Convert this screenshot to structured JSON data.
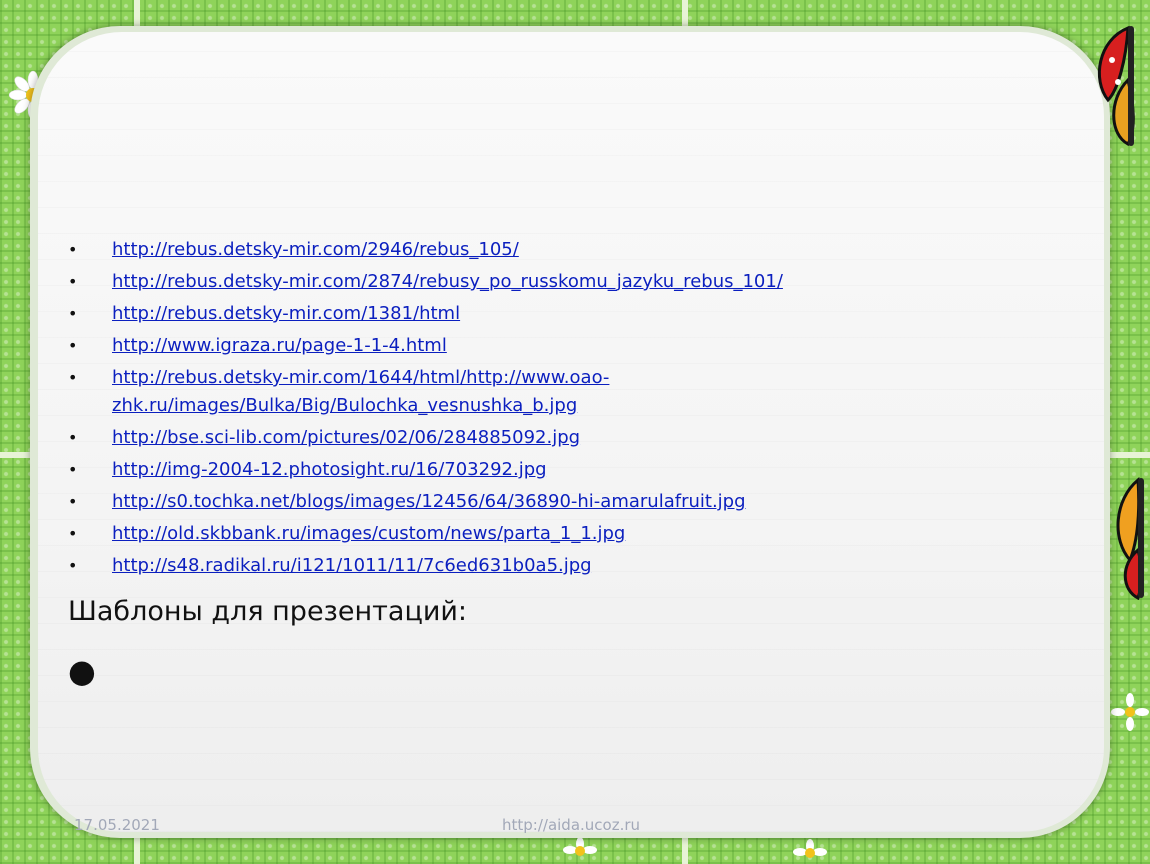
{
  "links": [
    {
      "text": "http://rebus.detsky-mir.com/2946/rebus_105/"
    },
    {
      "text": "http://rebus.detsky-mir.com/2874/rebusy_po_russkomu_jazyku_rebus_101/"
    },
    {
      "text": "http://rebus.detsky-mir.com/1381/html"
    },
    {
      "text": "http://www.igraza.ru/page-1-1-4.html"
    },
    {
      "text": "http://rebus.detsky-mir.com/1644/html/http://www.oao-",
      "text2": "zhk.ru/images/Bulka/Big/Bulochka_vesnushka_b.jpg"
    },
    {
      "text": "http://bse.sci-lib.com/pictures/02/06/284885092.jpg"
    },
    {
      "text": "http://img-2004-12.photosight.ru/16/703292.jpg"
    },
    {
      "text": "http://s0.tochka.net/blogs/images/12456/64/36890-hi-amarulafruit.jpg"
    },
    {
      "text": "http://old.skbbank.ru/images/custom/news/parta_1_1.jpg"
    },
    {
      "text": "http://s48.radikal.ru/i121/1011/11/7c6ed631b0a5.jpg"
    }
  ],
  "section_title": "Шаблоны для презентаций:",
  "bullet_glyph": "•",
  "big_bullet_glyph": "●",
  "footer": {
    "date": "17.05.2021",
    "url": "http://aida.ucoz.ru"
  },
  "colors": {
    "link": "#0b1fbf",
    "background": "#8fd35a",
    "footer": "#a2a8b8"
  },
  "decorations": [
    "butterfly-icon",
    "daisy-icon",
    "ladybug-icon"
  ]
}
